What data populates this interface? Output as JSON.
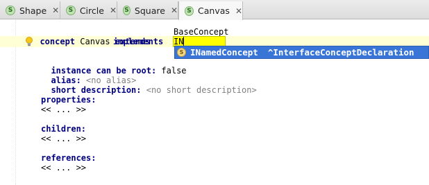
{
  "tabs": [
    {
      "label": "Shape",
      "icon_letter": "S",
      "closable": true
    },
    {
      "label": "Circle",
      "icon_letter": "S",
      "closable": true
    },
    {
      "label": "Square",
      "icon_letter": "S",
      "closable": true
    },
    {
      "label": "Canvas",
      "icon_letter": "S",
      "closable": true,
      "active": true
    }
  ],
  "close_glyph": "✕",
  "editor": {
    "concept_kw": "concept",
    "concept_name": "Canvas",
    "extends_kw": "extends",
    "extends_value": "BaseConcept",
    "implements_kw": "implements",
    "implements_input": "IN",
    "root_kw": "instance can be root:",
    "root_value": "false",
    "alias_kw": "alias:",
    "alias_value": "<no alias>",
    "short_desc_kw": "short description:",
    "short_desc_value": "<no short description>",
    "properties_kw": "properties:",
    "properties_value": "<< ... >>",
    "children_kw": "children:",
    "children_value": "<< ... >>",
    "references_kw": "references:",
    "references_value": "<< ... >>"
  },
  "completion": {
    "icon_letter": "S",
    "name": "INamedConcept",
    "type": "^InterfaceConceptDeclaration"
  },
  "icons": {
    "tab_icon": "concept-s-icon",
    "intention": "lightbulb-icon",
    "completion_icon": "concept-s-icon"
  },
  "colors": {
    "keyword": "#000080",
    "placeholder": "#808080",
    "selection": "#3875d7",
    "input_highlight": "#ffff00"
  }
}
